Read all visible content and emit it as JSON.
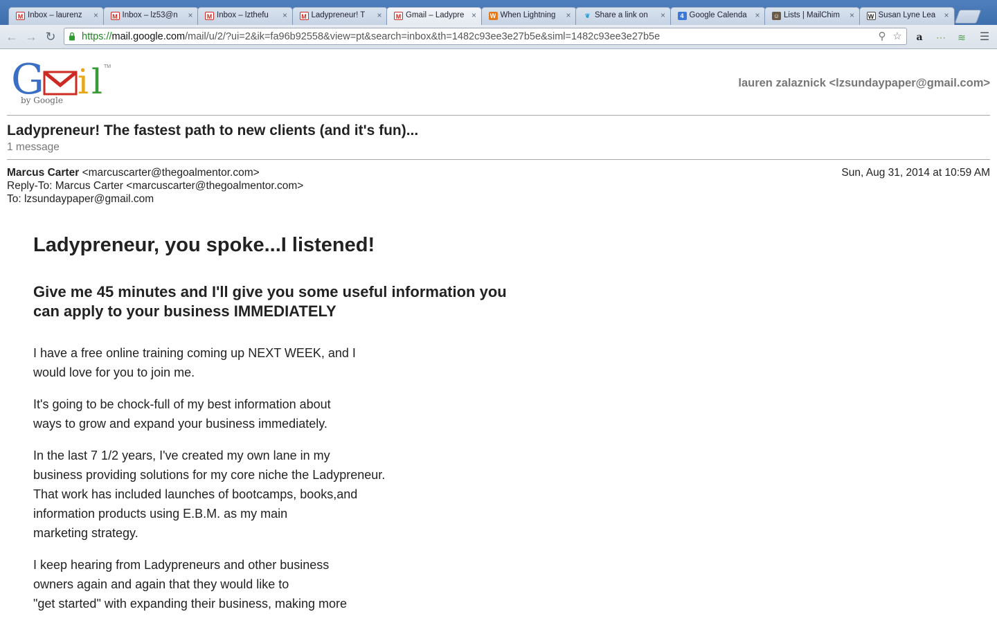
{
  "browser": {
    "tabs": [
      {
        "title": "Inbox – laurenz",
        "favicon": "gmail-icon",
        "active": false
      },
      {
        "title": "Inbox – lz53@n",
        "favicon": "gmail-icon",
        "active": false
      },
      {
        "title": "Inbox – lzthefu",
        "favicon": "gmail-icon",
        "active": false
      },
      {
        "title": "Ladypreneur! T",
        "favicon": "gmail-icon",
        "active": false
      },
      {
        "title": "Gmail – Ladypre",
        "favicon": "gmail-icon",
        "active": true
      },
      {
        "title": "When Lightning",
        "favicon": "w-icon",
        "active": false
      },
      {
        "title": "Share a link on",
        "favicon": "twitter-icon",
        "active": false
      },
      {
        "title": "Google Calenda",
        "favicon": "calendar-icon",
        "active": false
      },
      {
        "title": "Lists | MailChim",
        "favicon": "mailchimp-icon",
        "active": false
      },
      {
        "title": "Susan Lyne Lea",
        "favicon": "wsj-icon",
        "active": false
      }
    ],
    "url_scheme": "https://",
    "url_host": "mail.google.com",
    "url_rest": "/mail/u/2/?ui=2&ik=fa96b92558&view=pt&search=inbox&th=1482c93ee3e27b5e&siml=1482c93ee3e27b5e",
    "colors": {
      "tabstrip": "#4a79b8",
      "accent_green": "#1a8a1a"
    }
  },
  "gmail": {
    "logo_text": "Gmail",
    "logo_byline": "by Google",
    "account": "lauren zalaznick <lzsundaypaper@gmail.com>"
  },
  "thread": {
    "subject": "Ladypreneur! The fastest path to new clients (and it's fun)...",
    "count": "1 message"
  },
  "message": {
    "from_name": "Marcus Carter",
    "from_email": "<marcuscarter@thegoalmentor.com>",
    "reply_to": "Reply-To: Marcus Carter <marcuscarter@thegoalmentor.com>",
    "to": "To: lzsundaypaper@gmail.com",
    "date": "Sun, Aug 31, 2014 at 10:59 AM",
    "heading": "Ladypreneur, you spoke...I listened!",
    "subheading": "Give me 45 minutes and I'll give you some useful information you can apply to your business IMMEDIATELY",
    "paragraphs": [
      [
        "I have a free online training coming up NEXT WEEK, and I",
        "would love for you to join me."
      ],
      [
        "It's going to be chock-full of my best information about",
        "ways to grow and expand your business immediately."
      ],
      [
        "In the last 7 1/2 years, I've created my own lane in my",
        "business providing solutions for my core niche the Ladypreneur.",
        "That work has included launches of bootcamps, books,and",
        "information products using E.B.M. as my main",
        "marketing strategy."
      ],
      [
        "I keep hearing from Ladypreneurs and other business",
        "owners again and again that they would like to",
        "\"get started\" with expanding their business, making more"
      ]
    ]
  }
}
